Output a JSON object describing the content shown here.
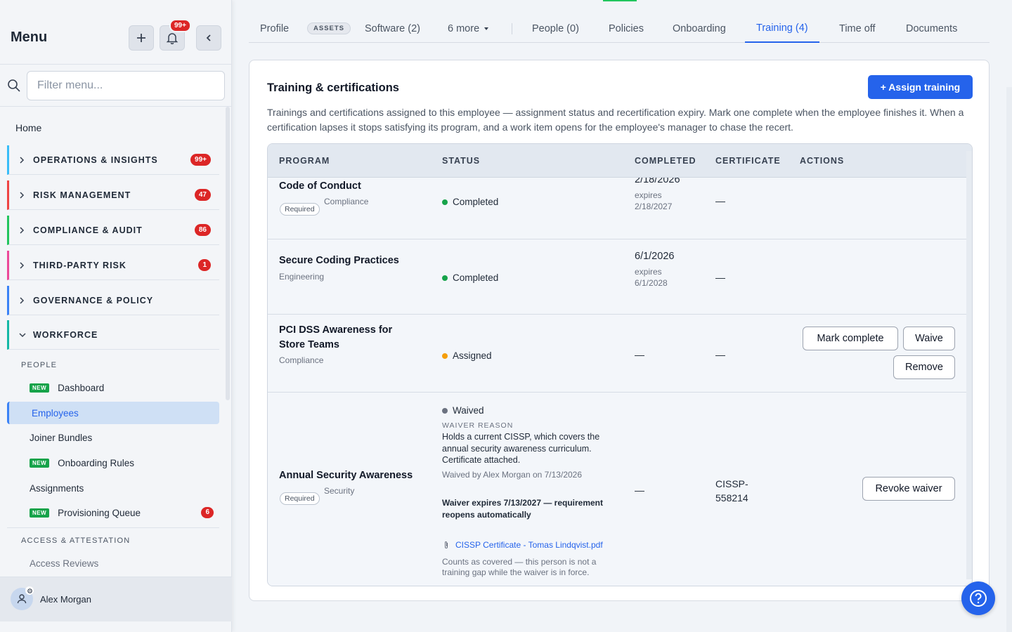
{
  "sidebar": {
    "title": "Menu",
    "notif_badge": "99+",
    "search_placeholder": "Filter menu...",
    "home": "Home",
    "sections": [
      {
        "label": "OPERATIONS & INSIGHTS",
        "count": "99+",
        "color": "#38bdf8"
      },
      {
        "label": "RISK MANAGEMENT",
        "count": "47",
        "color": "#ef4444"
      },
      {
        "label": "COMPLIANCE & AUDIT",
        "count": "86",
        "color": "#22c55e"
      },
      {
        "label": "THIRD-PARTY RISK",
        "count": "1",
        "color": "#ec4899"
      },
      {
        "label": "GOVERNANCE & POLICY",
        "count": "",
        "color": "#3b82f6"
      },
      {
        "label": "WORKFORCE",
        "count": "",
        "color": "#14b8a6"
      }
    ],
    "group_people": "PEOPLE",
    "items": [
      {
        "label": "Dashboard",
        "new": "NEW"
      },
      {
        "label": "Employees"
      },
      {
        "label": "Joiner Bundles"
      },
      {
        "label": "Onboarding Rules",
        "new": "NEW"
      },
      {
        "label": "Assignments"
      },
      {
        "label": "Provisioning Queue",
        "new": "NEW",
        "count": "6"
      }
    ],
    "group_access": "ACCESS & ATTESTATION",
    "access_reviews": "Access Reviews",
    "user": "Alex Morgan"
  },
  "tabs": {
    "profile": "Profile",
    "assets": "ASSETS",
    "software": "Software (2)",
    "more": "6 more",
    "people": "People (0)",
    "policies": "Policies",
    "onboarding": "Onboarding",
    "training": "Training (4)",
    "timeoff": "Time off",
    "documents": "Documents"
  },
  "card": {
    "title": "Training & certifications",
    "assign_button": "+ Assign training",
    "description": "Trainings and certifications assigned to this employee — assignment status and recertification expiry. Mark one complete when the employee finishes it. When a certification lapses it stops satisfying its program, and a work item opens for the employee's manager to chase the recert."
  },
  "table": {
    "headers": {
      "program": "PROGRAM",
      "status": "STATUS",
      "completed": "COMPLETED",
      "certificate": "CERTIFICATE",
      "actions": "ACTIONS"
    },
    "rows": [
      {
        "name": "Code of Conduct",
        "category": "Compliance",
        "required": "Required",
        "status": "Completed",
        "completed": "2/18/2026",
        "expires_label": "expires",
        "expires": "2/18/2027",
        "certificate": "—"
      },
      {
        "name": "Secure Coding Practices",
        "category": "Engineering",
        "status": "Completed",
        "completed": "6/1/2026",
        "expires_label": "expires",
        "expires": "6/1/2028",
        "certificate": "—"
      },
      {
        "name": "PCI DSS Awareness for Store Teams",
        "category": "Compliance",
        "status": "Assigned",
        "completed": "—",
        "certificate": "—",
        "actions": [
          "Mark complete",
          "Waive",
          "Remove"
        ]
      },
      {
        "name": "Annual Security Awareness",
        "category": "Security",
        "required": "Required",
        "status": "Waived",
        "waiver_reason_label": "WAIVER REASON",
        "waiver_reason": "Holds a current CISSP, which covers the annual security awareness curriculum. Certificate attached.",
        "waived_by": "Waived by Alex Morgan on 7/13/2026",
        "waiver_expiry": "Waiver expires 7/13/2027 — requirement reopens automatically",
        "attachment": "CISSP Certificate - Tomas Lindqvist.pdf",
        "note": "Counts as covered — this person is not a training gap while the waiver is in force.",
        "completed": "—",
        "certificate": "CISSP-558214",
        "action": "Revoke waiver"
      }
    ]
  },
  "colors": {
    "accent": "#2563eb",
    "completed": "#16a34a",
    "assigned": "#f59e0b",
    "waived": "#6b7280",
    "badge": "#dc2626"
  }
}
